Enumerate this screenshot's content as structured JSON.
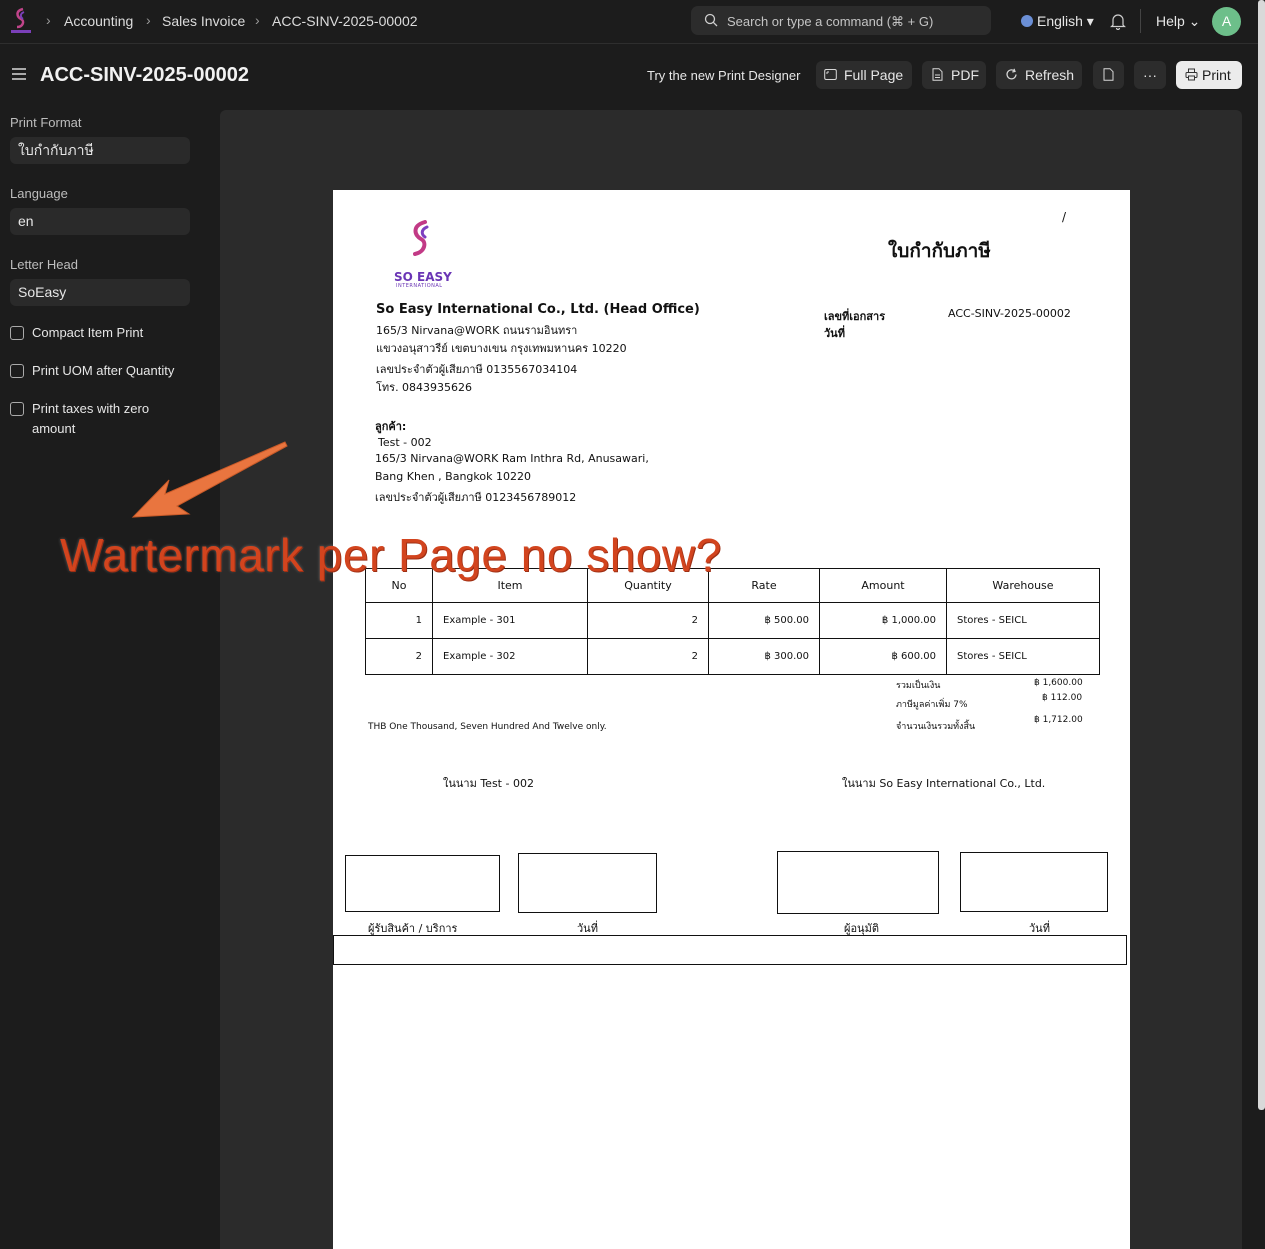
{
  "navbar": {
    "breadcrumbs": [
      "Accounting",
      "Sales Invoice",
      "ACC-SINV-2025-00002"
    ],
    "search_placeholder": "Search or type a command (⌘ + G)",
    "language": "English",
    "help": "Help",
    "avatar_initial": "A"
  },
  "header": {
    "title": "ACC-SINV-2025-00002",
    "designer_link": "Try the new Print Designer",
    "buttons": {
      "full_page": "Full Page",
      "pdf": "PDF",
      "refresh": "Refresh",
      "more": "···",
      "print": "Print"
    }
  },
  "sidebar": {
    "print_format_label": "Print Format",
    "print_format_value": "ใบกำกับภาษี",
    "language_label": "Language",
    "language_value": "en",
    "letter_head_label": "Letter Head",
    "letter_head_value": "SoEasy",
    "checkboxes": [
      {
        "label": "Compact Item Print",
        "checked": false
      },
      {
        "label": "Print UOM after Quantity",
        "checked": false
      },
      {
        "label": "Print taxes with zero",
        "label2": "amount",
        "checked": false
      }
    ]
  },
  "document": {
    "page_marker": "/",
    "doc_title": "ใบกำกับภาษี",
    "logo_text": "SO EASY",
    "logo_subtext": "INTERNATIONAL",
    "company_name": "So Easy International Co., Ltd. (Head Office)",
    "company_address_1": "165/3 Nirvana@WORK ถนนรามอินทรา",
    "company_address_2": "แขวงอนุสาวรีย์ เขตบางเขน กรุงเทพมหานคร 10220",
    "company_tax_id": "เลขประจำตัวผู้เสียภาษี  0135567034104",
    "company_phone": "โทร.  0843935626",
    "doc_no_label": "เลขที่เอกสาร",
    "doc_no_value": "ACC-SINV-2025-00002",
    "date_label": "วันที่",
    "customer_label": "ลูกค้า:",
    "customer_name": "Test - 002",
    "customer_address_1": "165/3 Nirvana@WORK Ram Inthra Rd, Anusawari,",
    "customer_address_2": "Bang Khen , Bangkok 10220",
    "customer_tax_id": "เลขประจำตัวผู้เสียภาษี  0123456789012",
    "table_headers": [
      "No",
      "Item",
      "Quantity",
      "Rate",
      "Amount",
      "Warehouse"
    ],
    "rows": [
      {
        "no": "1",
        "item": "Example - 301",
        "qty": "2",
        "rate": "฿ 500.00",
        "amount": "฿ 1,000.00",
        "warehouse": "Stores - SEICL"
      },
      {
        "no": "2",
        "item": "Example - 302",
        "qty": "2",
        "rate": "฿ 300.00",
        "amount": "฿ 600.00",
        "warehouse": "Stores - SEICL"
      }
    ],
    "subtotal_label": "รวมเป็นเงิน",
    "subtotal_value": "฿ 1,600.00",
    "vat_label": "ภาษีมูลค่าเพิ่ม 7%",
    "vat_value": "฿ 112.00",
    "grand_total_label": "จำนวนเงินรวมทั้งสิ้น",
    "grand_total_value": "฿ 1,712.00",
    "in_words": "THB One Thousand, Seven Hundred And Twelve only.",
    "sign_customer": "ในนาม  Test - 002",
    "sign_company": "ในนาม  So Easy International Co., Ltd.",
    "sig_receiver": "ผู้รับสินค้า / บริการ",
    "sig_date": "วันที่",
    "sig_approver": "ผู้อนุมัติ"
  },
  "annotation": {
    "text": "Wartermark per Page no show?",
    "color": "#d2441e"
  }
}
